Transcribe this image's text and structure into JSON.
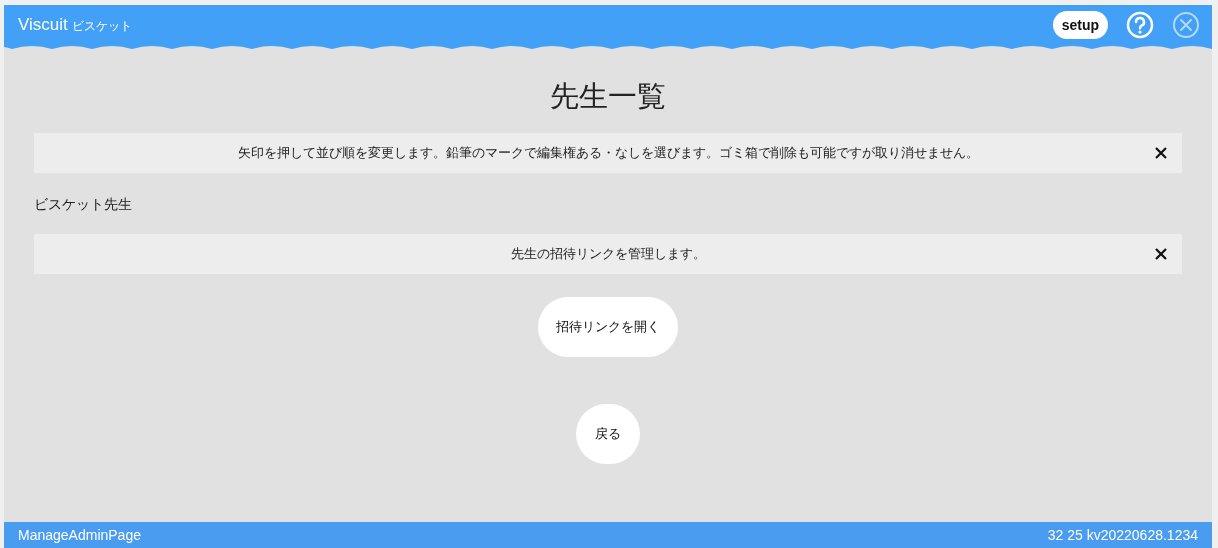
{
  "header": {
    "logo": "Viscuit",
    "logo_sub": "ビスケット",
    "setup_button": "setup"
  },
  "title": "先生一覧",
  "notices": [
    {
      "text": "矢印を押して並び順を変更します。鉛筆のマークで編集権ある・なしを選びます。ゴミ箱で削除も可能ですが取り消せません。"
    }
  ],
  "teacher_name": "ビスケット先生",
  "invite_notice": {
    "text": "先生の招待リンクを管理します。"
  },
  "buttons": [
    {
      "label": "招待リンクを開く"
    },
    {
      "label": "戻る"
    }
  ],
  "status_bar": {
    "page": "ManageAdminPage",
    "version": "32 25 kv20220628.1234"
  }
}
